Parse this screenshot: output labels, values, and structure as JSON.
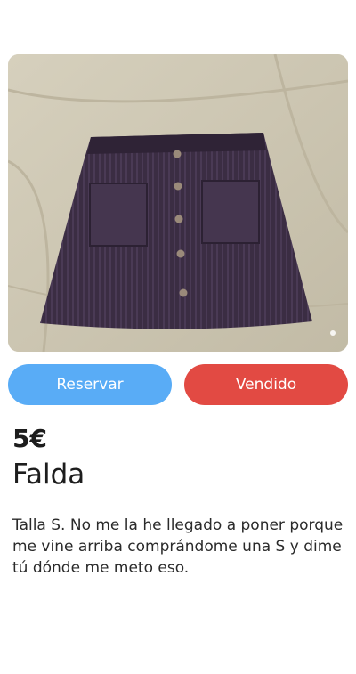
{
  "item": {
    "photo_alt": "",
    "price": "5€",
    "title": "Falda",
    "description": "Talla S. No me la he llegado a poner porque me vine arriba comprándome una S y dime tú dónde me meto eso."
  },
  "actions": {
    "reserve_label": "Reservar",
    "sold_label": "Vendido"
  },
  "colors": {
    "reserve": "#59acf6",
    "sold": "#e24a43",
    "text": "#1d1d1d"
  }
}
